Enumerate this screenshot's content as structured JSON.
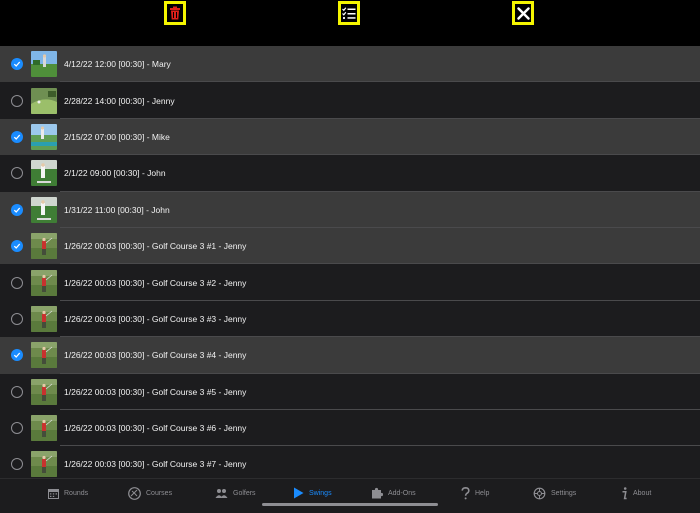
{
  "toolbar": {
    "delete_icon": "trash-icon",
    "select_icon": "checklist-icon",
    "close_icon": "close-icon",
    "highlight_color": "#f5f500",
    "delete_color": "#e0201a"
  },
  "swings": [
    {
      "label": "4/12/22 12:00 [00:30] - Mary",
      "selected": true,
      "thumb": "course-sky"
    },
    {
      "label": "2/28/22 14:00 [00:30] - Jenny",
      "selected": false,
      "thumb": "course-green"
    },
    {
      "label": "2/15/22 07:00 [00:30] - Mike",
      "selected": true,
      "thumb": "course-range"
    },
    {
      "label": "2/1/22 09:00 [00:30] - John",
      "selected": false,
      "thumb": "course-white"
    },
    {
      "label": "1/31/22 11:00 [00:30] - John",
      "selected": true,
      "thumb": "course-white"
    },
    {
      "label": "1/26/22 00:03 [00:30] - Golf Course 3 #1 - Jenny",
      "selected": true,
      "thumb": "golfer-red"
    },
    {
      "label": "1/26/22 00:03 [00:30] - Golf Course 3 #2 - Jenny",
      "selected": false,
      "thumb": "golfer-red"
    },
    {
      "label": "1/26/22 00:03 [00:30] - Golf Course 3 #3 - Jenny",
      "selected": false,
      "thumb": "golfer-red"
    },
    {
      "label": "1/26/22 00:03 [00:30] - Golf Course 3 #4 - Jenny",
      "selected": true,
      "thumb": "golfer-red"
    },
    {
      "label": "1/26/22 00:03 [00:30] - Golf Course 3 #5 - Jenny",
      "selected": false,
      "thumb": "golfer-red"
    },
    {
      "label": "1/26/22 00:03 [00:30] - Golf Course 3 #6 - Jenny",
      "selected": false,
      "thumb": "golfer-red"
    },
    {
      "label": "1/26/22 00:03 [00:30] - Golf Course 3 #7 - Jenny",
      "selected": false,
      "thumb": "golfer-red"
    }
  ],
  "tabs": [
    {
      "label": "Rounds",
      "icon": "calendar-icon",
      "active": false
    },
    {
      "label": "Courses",
      "icon": "golf-ball-icon",
      "active": false
    },
    {
      "label": "Golfers",
      "icon": "golfers-icon",
      "active": false
    },
    {
      "label": "Swings",
      "icon": "play-icon",
      "active": true
    },
    {
      "label": "Add-Ons",
      "icon": "puzzle-icon",
      "active": false
    },
    {
      "label": "Help",
      "icon": "question-icon",
      "active": false
    },
    {
      "label": "Settings",
      "icon": "gear-icon",
      "active": false
    },
    {
      "label": "About",
      "icon": "info-icon",
      "active": false
    }
  ],
  "colors": {
    "accent": "#1a8cff",
    "selected_row": "#3b3b3b",
    "row": "#1c1c1e",
    "tab_inactive": "#8e8e93"
  }
}
